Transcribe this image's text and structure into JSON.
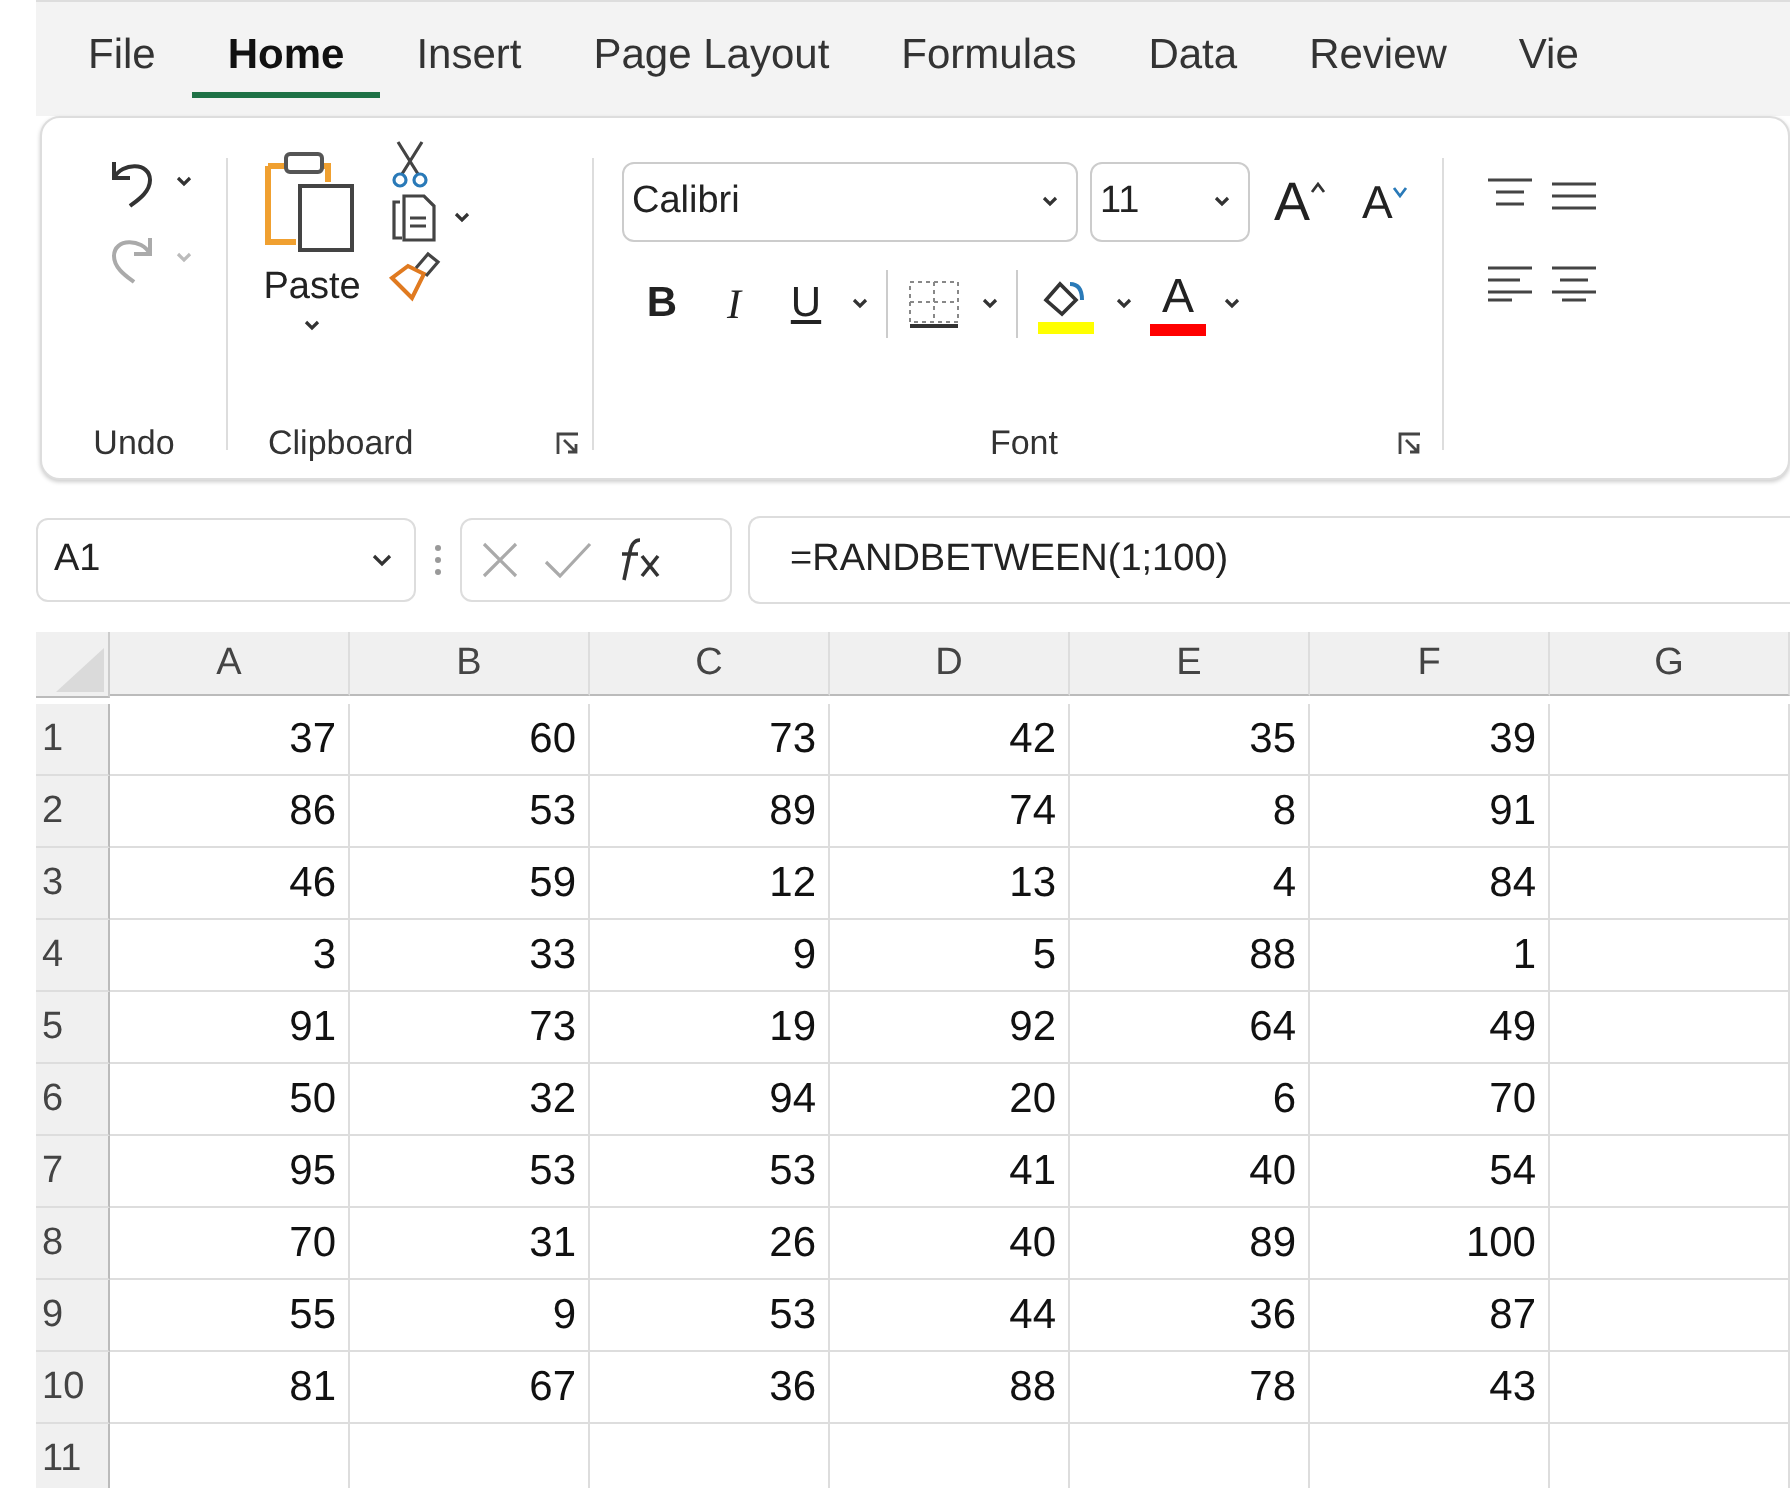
{
  "tabs": [
    {
      "label": "File",
      "selected": false
    },
    {
      "label": "Home",
      "selected": true
    },
    {
      "label": "Insert",
      "selected": false
    },
    {
      "label": "Page Layout",
      "selected": false
    },
    {
      "label": "Formulas",
      "selected": false
    },
    {
      "label": "Data",
      "selected": false
    },
    {
      "label": "Review",
      "selected": false
    },
    {
      "label": "Vie",
      "selected": false
    }
  ],
  "ribbon": {
    "undo_group": {
      "label": "Undo",
      "redo_disabled": true
    },
    "clipboard_group": {
      "label": "Clipboard",
      "paste_label": "Paste"
    },
    "font_group": {
      "label": "Font",
      "font_name": "Calibri",
      "font_size": "11",
      "grow_font": "A",
      "shrink_font": "A",
      "bold": "B",
      "italic": "I",
      "underline": "U",
      "font_color_letter": "A"
    }
  },
  "formula_bar": {
    "name_box": "A1",
    "formula": "=RANDBETWEEN(1;100)"
  },
  "sheet": {
    "columns": [
      "A",
      "B",
      "C",
      "D",
      "E",
      "F",
      "G"
    ],
    "rows": [
      {
        "header": "1",
        "cells": [
          "37",
          "60",
          "73",
          "42",
          "35",
          "39"
        ]
      },
      {
        "header": "2",
        "cells": [
          "86",
          "53",
          "89",
          "74",
          "8",
          "91"
        ]
      },
      {
        "header": "3",
        "cells": [
          "46",
          "59",
          "12",
          "13",
          "4",
          "84"
        ]
      },
      {
        "header": "4",
        "cells": [
          "3",
          "33",
          "9",
          "5",
          "88",
          "1"
        ]
      },
      {
        "header": "5",
        "cells": [
          "91",
          "73",
          "19",
          "92",
          "64",
          "49"
        ]
      },
      {
        "header": "6",
        "cells": [
          "50",
          "32",
          "94",
          "20",
          "6",
          "70"
        ]
      },
      {
        "header": "7",
        "cells": [
          "95",
          "53",
          "53",
          "41",
          "40",
          "54"
        ]
      },
      {
        "header": "8",
        "cells": [
          "70",
          "31",
          "26",
          "40",
          "89",
          "100"
        ]
      },
      {
        "header": "9",
        "cells": [
          "55",
          "9",
          "53",
          "44",
          "36",
          "87"
        ]
      },
      {
        "header": "10",
        "cells": [
          "81",
          "67",
          "36",
          "88",
          "78",
          "43"
        ]
      },
      {
        "header": "11",
        "cells": []
      }
    ]
  }
}
